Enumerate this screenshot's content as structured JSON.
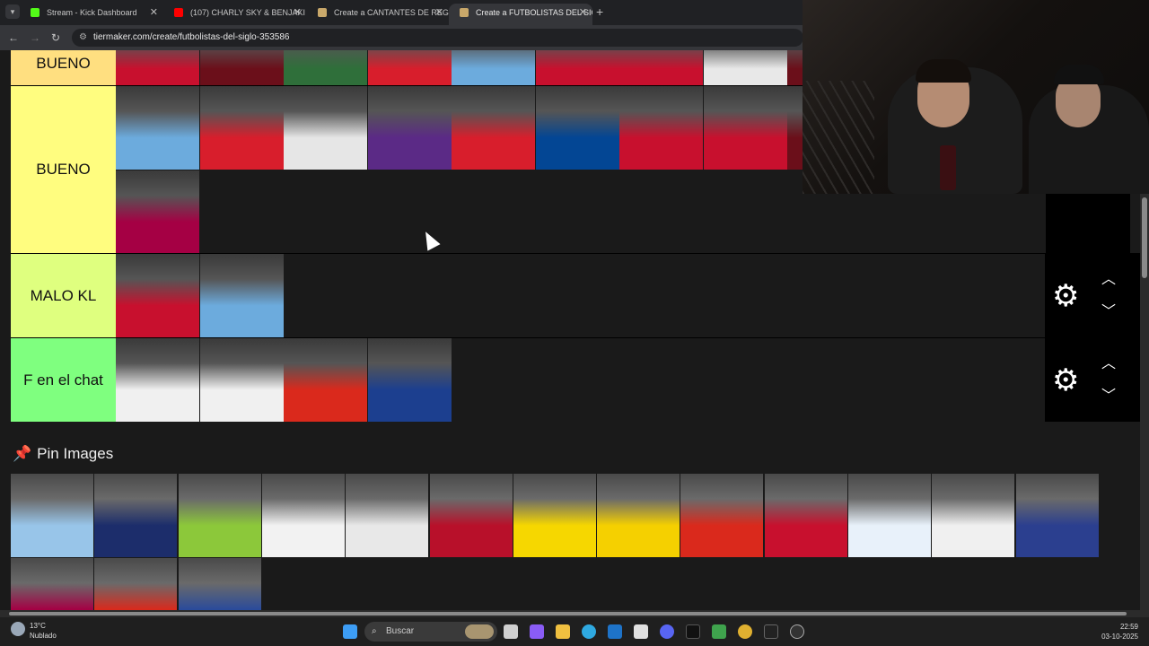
{
  "browser": {
    "tabs": [
      {
        "title": "Stream - Kick Dashboard",
        "favicon_color": "#53fc18"
      },
      {
        "title": "(107) CHARLY SKY & BENJAKI -",
        "favicon_color": "#ff0000"
      },
      {
        "title": "Create a CANTANTES DE REGG",
        "favicon_color": "#c9a86a"
      },
      {
        "title": "Create a FUTBOLISTAS DEL SIGL",
        "favicon_color": "#c9a86a",
        "active": true
      }
    ],
    "new_tab": "+",
    "back": "←",
    "forward": "→",
    "reload": "↻",
    "url": "tiermaker.com/create/futbolistas-del-siglo-353586"
  },
  "tiers": [
    {
      "label": "BUENO",
      "color": "#ffdf80",
      "item_colors": [
        "#c8102e",
        "#6b0f1a",
        "#2f6f3a",
        "#d81e2c",
        "#6cabdd",
        "#c8102e",
        "#c8102e",
        "#e8e8e8",
        "#6b0f1a"
      ]
    },
    {
      "label": "BUENO",
      "color": "#fffd7f",
      "item_colors": [
        "#6cabdd",
        "#d81e2c",
        "#e6e6e6",
        "#5b2a86",
        "#d81e2c",
        "#034694",
        "#c8102e",
        "#c8102e",
        "#6b0f1a",
        "#a50044"
      ]
    },
    {
      "label": "MALO KL",
      "color": "#dfff7f",
      "item_colors": [
        "#c8102e",
        "#6cabdd"
      ]
    },
    {
      "label": "F en el chat",
      "color": "#7fff7f",
      "item_colors": [
        "#f0f0f0",
        "#f0f0f0",
        "#da291c",
        "#1c3f8f"
      ]
    }
  ],
  "pin_images": {
    "title": "Pin Images",
    "item_colors": [
      "#98c5e9",
      "#1c2d6b",
      "#8cc83a",
      "#f2f2f2",
      "#e8e8e8",
      "#b8102a",
      "#f6d700",
      "#f5d000",
      "#da291c",
      "#c8102e",
      "#e8f1fa",
      "#f0f0f0",
      "#2b3f8f",
      "#a50044",
      "#da291c",
      "#2a4b9b"
    ]
  },
  "taskbar": {
    "weather_temp": "13°C",
    "weather_desc": "Nublado",
    "search_placeholder": "Buscar",
    "time": "22:59",
    "date": "03-10-2025"
  }
}
